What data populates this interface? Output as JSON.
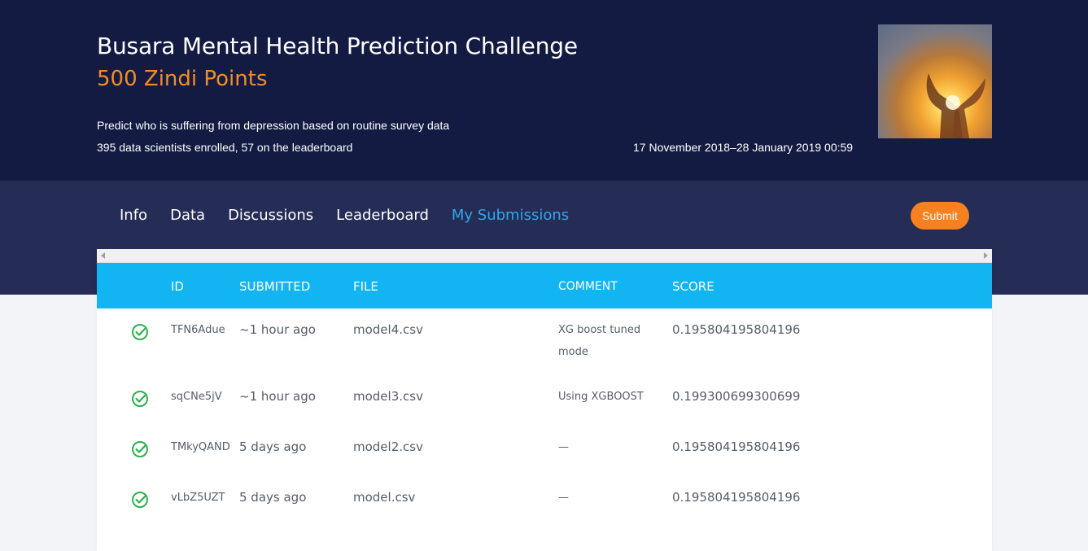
{
  "challenge": {
    "title": "Busara Mental Health Prediction Challenge",
    "points": "500 Zindi Points",
    "description": "Predict who is suffering from depression based on routine survey data",
    "enrollment": "395 data scientists enrolled, 57 on the leaderboard",
    "dates": "17 November 2018–28 January 2019 00:59"
  },
  "nav": {
    "tabs": [
      "Info",
      "Data",
      "Discussions",
      "Leaderboard",
      "My Submissions"
    ],
    "active_tab": "My Submissions",
    "submit_label": "Submit"
  },
  "table": {
    "headers": {
      "id": "ID",
      "submitted": "SUBMITTED",
      "file": "FILE",
      "comment": "COMMENT",
      "score": "SCORE"
    },
    "rows": [
      {
        "id": "TFN6Adue",
        "submitted": "~1 hour ago",
        "file": "model4.csv",
        "comment": "XG boost tuned mode",
        "score": "0.195804195804196"
      },
      {
        "id": "sqCNe5jV",
        "submitted": "~1 hour ago",
        "file": "model3.csv",
        "comment": "Using XGBOOST",
        "score": "0.199300699300699"
      },
      {
        "id": "TMkyQAND",
        "submitted": "5 days ago",
        "file": "model2.csv",
        "comment": "—",
        "score": "0.195804195804196"
      },
      {
        "id": "vLbZ5UZT",
        "submitted": "5 days ago",
        "file": "model.csv",
        "comment": "—",
        "score": "0.195804195804196"
      }
    ]
  },
  "colors": {
    "hero_bg": "#131b42",
    "nav_bg": "#252d56",
    "accent_orange": "#f7801f",
    "points_orange": "#f28c28",
    "active_tab_blue": "#2ea8ea",
    "table_header_blue": "#13b4f2",
    "check_green": "#2bb24c"
  },
  "icons": {
    "status": "check-circle-icon",
    "hero_image": "hands-sunset-image"
  }
}
